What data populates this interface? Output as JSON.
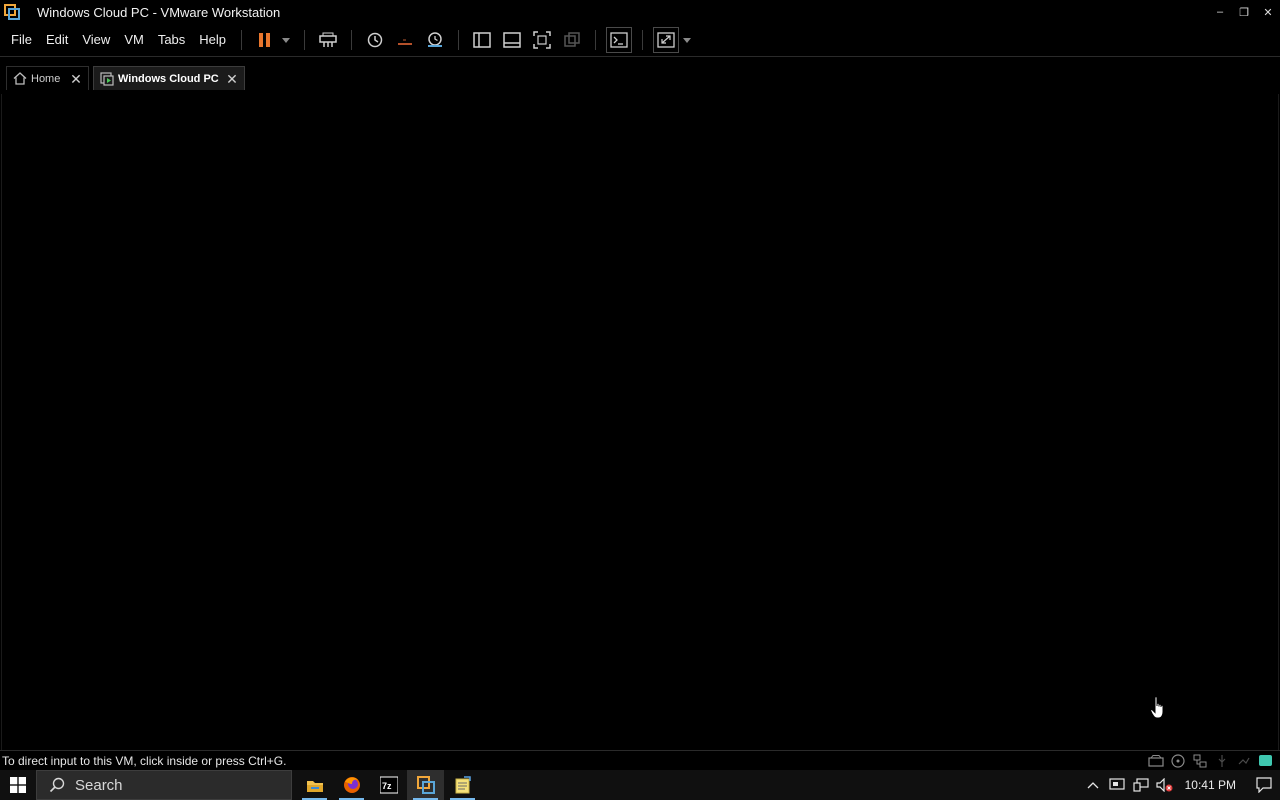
{
  "window": {
    "title": "Windows Cloud PC - VMware Workstation",
    "controls": {
      "minimize": "–",
      "restore": "❐",
      "close": "✕"
    }
  },
  "menu": {
    "items": [
      "File",
      "Edit",
      "View",
      "VM",
      "Tabs",
      "Help"
    ]
  },
  "toolbar": {
    "icons": [
      "pause-icon",
      "send-ctrl-alt-del-icon",
      "snapshot-icon",
      "revert-snapshot-icon",
      "snapshot-manager-icon",
      "library-view-icon",
      "thumbnail-bar-icon",
      "full-screen-icon",
      "unity-icon",
      "console-view-icon",
      "stretch-guest-icon"
    ],
    "accent_color": "#e8762d"
  },
  "tabs": [
    {
      "label": "Home",
      "active": false
    },
    {
      "label": "Windows Cloud PC",
      "active": true
    }
  ],
  "status": {
    "message": "To direct input to this VM, click inside or press Ctrl+G."
  },
  "taskbar": {
    "search_label": "Search",
    "apps": [
      "file-explorer-icon",
      "firefox-icon",
      "7zip-icon",
      "vmware-icon",
      "notepad-icon"
    ],
    "active_app": "vmware-icon",
    "clock": "10:41 PM"
  }
}
